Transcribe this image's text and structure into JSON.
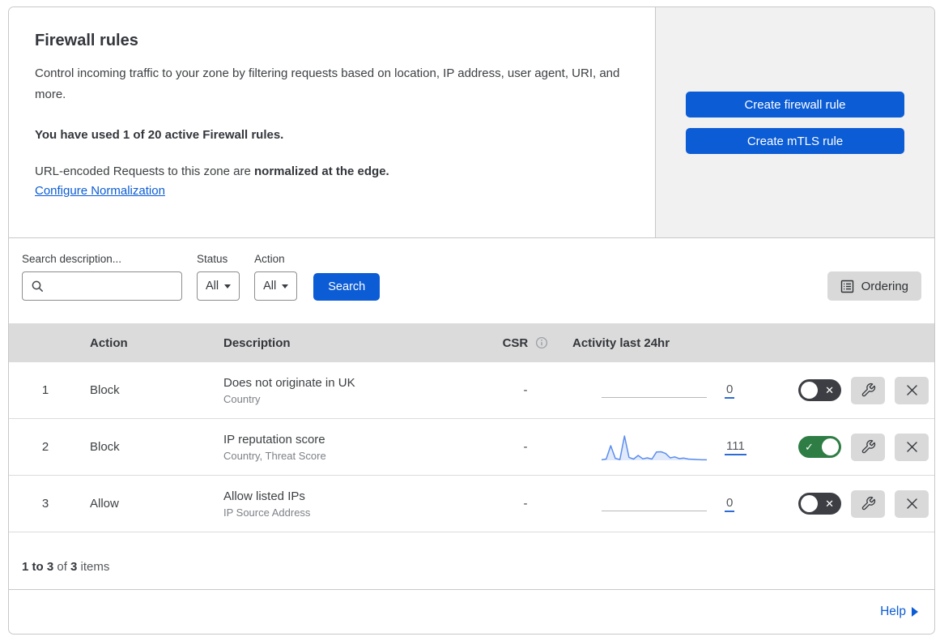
{
  "header": {
    "title": "Firewall rules",
    "description": "Control incoming traffic to your zone by filtering requests based on location, IP address, user agent, URI, and more.",
    "usage": "You have used 1 of 20 active Firewall rules.",
    "normalization_text": "URL-encoded Requests to this zone are ",
    "normalization_bold": "normalized at the edge.",
    "normalization_link": "Configure Normalization",
    "buttons": {
      "create_firewall": "Create firewall rule",
      "create_mtls": "Create mTLS rule"
    }
  },
  "filters": {
    "search_label": "Search description...",
    "search_input_value": "",
    "status_label": "Status",
    "status_value": "All",
    "action_label": "Action",
    "action_value": "All",
    "search_button": "Search",
    "ordering_button": "Ordering"
  },
  "table": {
    "headers": {
      "action": "Action",
      "description": "Description",
      "csr": "CSR",
      "activity": "Activity last 24hr"
    },
    "rows": [
      {
        "num": "1",
        "action": "Block",
        "description": "Does not originate in UK",
        "fields": "Country",
        "csr": "-",
        "activity_count": "0",
        "enabled": false,
        "has_sparkline": false
      },
      {
        "num": "2",
        "action": "Block",
        "description": "IP reputation score",
        "fields": "Country, Threat Score",
        "csr": "-",
        "activity_count": "111",
        "enabled": true,
        "has_sparkline": true
      },
      {
        "num": "3",
        "action": "Allow",
        "description": "Allow listed IPs",
        "fields": "IP Source Address",
        "csr": "-",
        "activity_count": "0",
        "enabled": false,
        "has_sparkline": false
      }
    ]
  },
  "footer": {
    "range": "1 to 3",
    "of": " of ",
    "total": "3",
    "items": " items",
    "help_label": "Help"
  },
  "toggle": {
    "on_glyph": "✓",
    "off_glyph": "✕"
  },
  "colors": {
    "primary_blue": "#0b5cd5",
    "toggle_on_green": "#2e7d44",
    "toggle_off_gray": "#3c3e43",
    "sparkline_line": "#5b8def",
    "sparkline_fill": "#dce6f9",
    "panel_gray": "#f1f1f1",
    "table_header_gray": "#dbdbdb"
  },
  "chart_data": {
    "type": "line",
    "title": "Activity last 24hr sparkline (rule 2)",
    "x": "hours (last 24)",
    "values": [
      2,
      5,
      60,
      8,
      3,
      100,
      12,
      5,
      20,
      6,
      10,
      5,
      34,
      35,
      28,
      10,
      14,
      7,
      9,
      5,
      4,
      3,
      2,
      2
    ],
    "total_label": "111",
    "ylim": [
      0,
      100
    ],
    "grid": false
  }
}
